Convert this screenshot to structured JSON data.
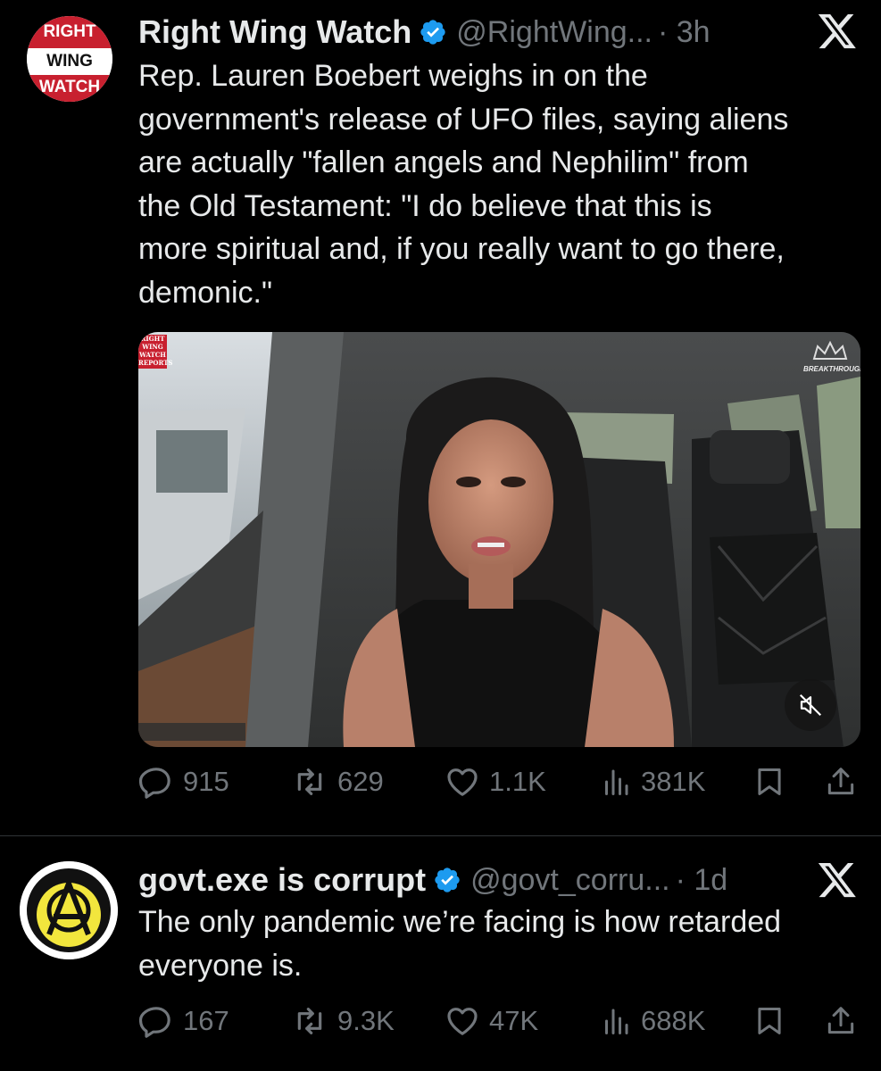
{
  "tweets": [
    {
      "avatar_text": [
        "RIGHT",
        "WING",
        "WATCH"
      ],
      "name": "Right Wing Watch",
      "handle": "@RightWing...",
      "time": "· 3h",
      "text_lines": [
        "Rep. Lauren Boebert weighs in on the",
        "government's release of UFO files, saying aliens",
        "are actually \"fallen angels and Nephilim\" from",
        "the Old Testament: \"I do believe that this is",
        "more spiritual and, if you really want to go there,",
        "demonic.\""
      ],
      "media": {
        "corner_logo": [
          "RIGHT",
          "WING",
          "WATCH",
          "REPORTS"
        ],
        "watermark": "BREAKTHROUGH",
        "mute_icon": "muted-speaker-icon"
      },
      "actions": {
        "replies": "915",
        "reposts": "629",
        "likes": "1.1K",
        "views": "381K"
      }
    },
    {
      "name": "govt.exe is corrupt",
      "handle": "@govt_corru...",
      "time": "· 1d",
      "text_lines": [
        "The only pandemic we’re facing is how retarded",
        "everyone is."
      ],
      "actions": {
        "replies": "167",
        "reposts": "9.3K",
        "likes": "47K",
        "views": "688K"
      }
    }
  ],
  "colors": {
    "verified": "#1d9bf0",
    "muted": "#71767b",
    "text": "#e7e9ea",
    "avatar_red": "#c8202f",
    "avatar_yellow": "#f2e63d"
  }
}
